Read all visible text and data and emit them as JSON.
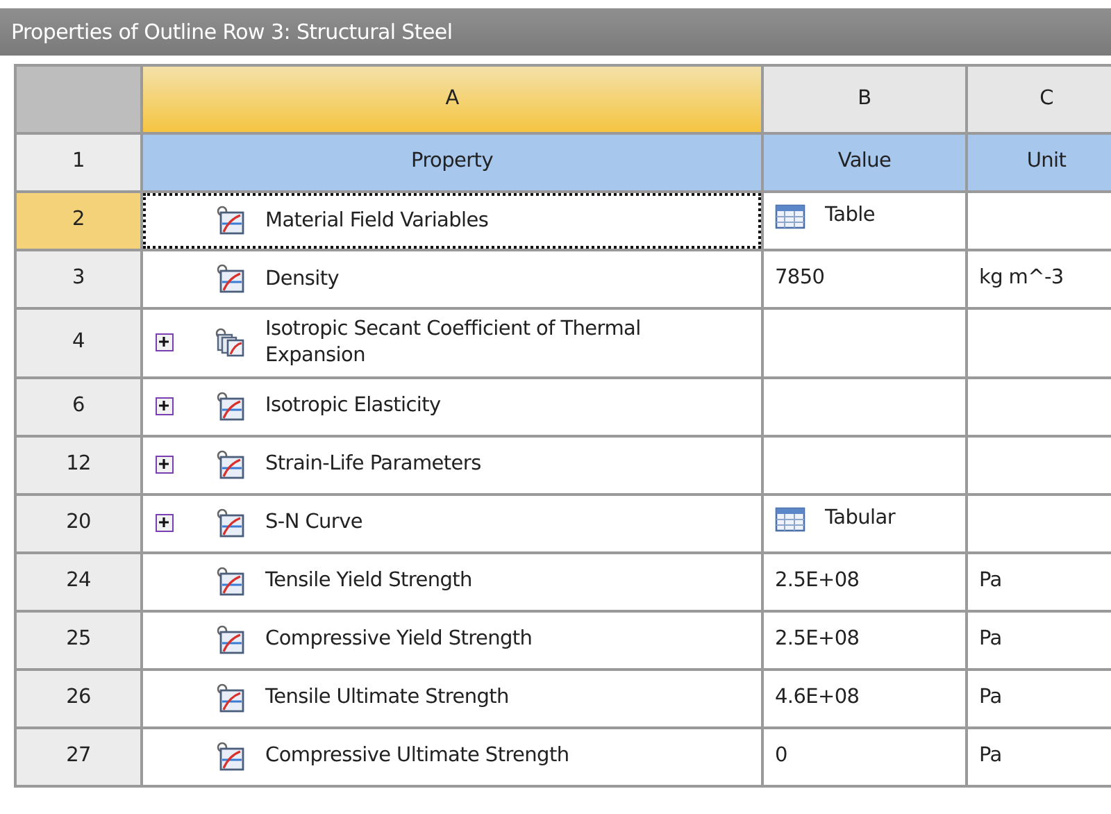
{
  "window": {
    "title": "Properties of Outline Row 3: Structural Steel"
  },
  "columns": [
    "A",
    "B",
    "C"
  ],
  "header": {
    "number": "1",
    "cells": [
      "Property",
      "Value",
      "Unit"
    ]
  },
  "rows": [
    {
      "number": "2",
      "selected": true,
      "expandable": false,
      "kind": "single",
      "property": "Material Field Variables",
      "value": {
        "kind": "table",
        "text": "Table"
      },
      "unit": ""
    },
    {
      "number": "3",
      "selected": false,
      "expandable": false,
      "kind": "single",
      "property": "Density",
      "value": {
        "kind": "plain",
        "text": "7850"
      },
      "unit": "kg m^-3"
    },
    {
      "number": "4",
      "selected": false,
      "expandable": true,
      "kind": "group",
      "property": "Isotropic Secant Coefficient of Thermal Expansion",
      "unit": ""
    },
    {
      "number": "6",
      "selected": false,
      "expandable": true,
      "kind": "single",
      "property": "Isotropic Elasticity",
      "unit": ""
    },
    {
      "number": "12",
      "selected": false,
      "expandable": true,
      "kind": "single",
      "property": "Strain-Life Parameters",
      "unit": ""
    },
    {
      "number": "20",
      "selected": false,
      "expandable": true,
      "kind": "single",
      "property": "S-N Curve",
      "value": {
        "kind": "table",
        "text": "Tabular"
      },
      "unit": ""
    },
    {
      "number": "24",
      "selected": false,
      "expandable": false,
      "kind": "single",
      "property": "Tensile Yield Strength",
      "value": {
        "kind": "plain",
        "text": "2.5E+08"
      },
      "unit": "Pa"
    },
    {
      "number": "25",
      "selected": false,
      "expandable": false,
      "kind": "single",
      "property": "Compressive Yield Strength",
      "value": {
        "kind": "plain",
        "text": "2.5E+08"
      },
      "unit": "Pa"
    },
    {
      "number": "26",
      "selected": false,
      "expandable": false,
      "kind": "single",
      "property": "Tensile Ultimate Strength",
      "value": {
        "kind": "plain",
        "text": "4.6E+08"
      },
      "unit": "Pa"
    },
    {
      "number": "27",
      "selected": false,
      "expandable": false,
      "kind": "single",
      "property": "Compressive Ultimate Strength",
      "value": {
        "kind": "plain",
        "text": "0"
      },
      "unit": "Pa"
    }
  ]
}
